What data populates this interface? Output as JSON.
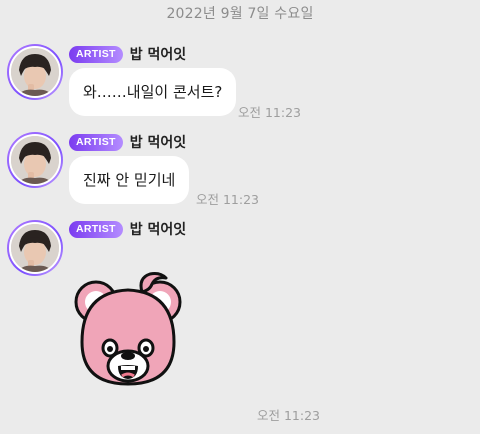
{
  "date_separator": "2022년 9월 7일 수요일",
  "badge_label": "ARTIST",
  "messages": [
    {
      "sender": "밥 먹어잇",
      "text": "와……내일이 콘서트?",
      "time": "오전 11:23"
    },
    {
      "sender": "밥 먹어잇",
      "text": "진짜 안 믿기네",
      "time": "오전 11:23"
    },
    {
      "sender": "밥 먹어잇",
      "sticker": "pink-bear-sticker",
      "time": "오전 11:23"
    }
  ],
  "colors": {
    "badge_start": "#7b3cf0",
    "badge_end": "#b48cff",
    "avatar_ring": "#9a6bff",
    "bear_pink": "#f0a5b8"
  }
}
